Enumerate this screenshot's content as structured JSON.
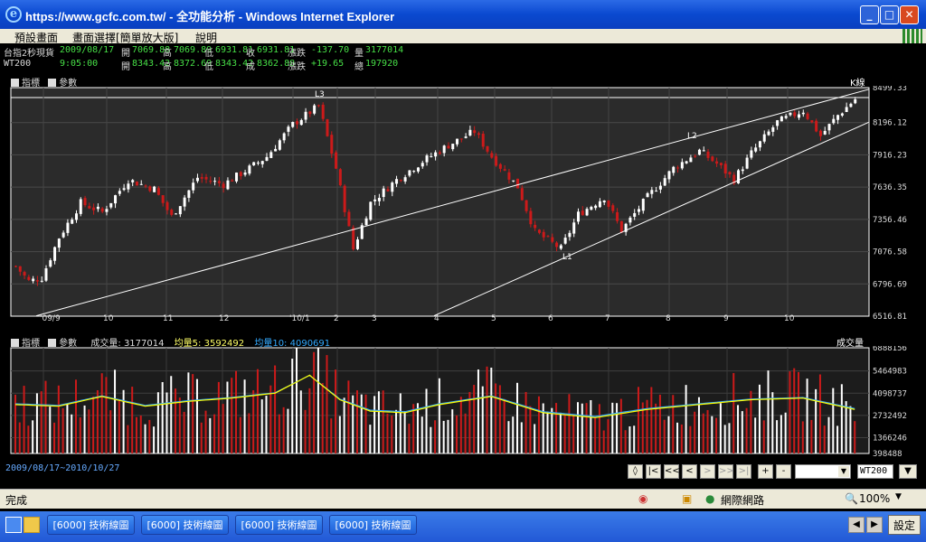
{
  "window": {
    "title": "https://www.gcfc.com.tw/ - 全功能分析 - Windows Internet Explorer"
  },
  "menu": [
    "預設畫面",
    "畫面選擇[簡單放大版]",
    "說明"
  ],
  "quotes": [
    {
      "name": "台指2秒現貨",
      "time": "2009/08/17",
      "open_label": "開",
      "open": "7069.88",
      "high_label": "高",
      "high": "7069.89",
      "low_label": "低",
      "low": "6931.81",
      "close_label": "收",
      "close": "6931.81",
      "chg_label": "漲跌",
      "chg": "-137.70",
      "vol_label": "量",
      "vol": "3177014"
    },
    {
      "name": "WT200",
      "time": "9:05:00",
      "open_label": "開",
      "open": "8343.42",
      "high_label": "高",
      "high": "8372.69",
      "low_label": "低",
      "low": "8343.42",
      "close_label": "成",
      "close": "8362.88",
      "chg_label": "漲跌",
      "chg": "+19.65",
      "vol_label": "總",
      "vol": "197920"
    }
  ],
  "price_panel": {
    "tool_indicator": "指標",
    "tool_params": "參數",
    "chart_label": "K線",
    "y_ticks": [
      "8499.33",
      "8196.12",
      "7916.23",
      "7636.35",
      "7356.46",
      "7076.58",
      "6796.69",
      "6516.81"
    ],
    "x_ticks": [
      "'09/9",
      "10",
      "11",
      "12",
      "'10/1",
      "2",
      "3",
      "4",
      "5",
      "6",
      "7",
      "8",
      "9",
      "10"
    ],
    "annotations": [
      "L3",
      "L2",
      "L1"
    ]
  },
  "volume_panel": {
    "tool_indicator": "指標",
    "tool_params": "參數",
    "vol_label": "成交量:",
    "vol_value": "3177014",
    "ma5_label": "均量5:",
    "ma5_value": "3592492",
    "ma10_label": "均量10:",
    "ma10_value": "4090691",
    "chart_label": "成交量",
    "y_ticks": [
      "6888156",
      "5464983",
      "4098737",
      "2732492",
      "1366246",
      "398488"
    ]
  },
  "date_range": "2009/08/17~2010/10/27",
  "nav_buttons": [
    "|<",
    "<<",
    "<",
    ">",
    ">>",
    ">|",
    "+",
    "-"
  ],
  "symbol_input": "WT200",
  "status": {
    "done": "完成",
    "zone": "網際網路",
    "zoom": "100%"
  },
  "taskbar": {
    "tasks": [
      "[6000] 技術線圖",
      "[6000] 技術線圖",
      "[6000] 技術線圖",
      "[6000] 技術線圖"
    ],
    "settings": "設定"
  },
  "colors": {
    "down_candle": "#cc1a1a",
    "up_candle": "#ffffff",
    "ma5": "#ffff00",
    "ma10": "#33aaff"
  },
  "chart_data": {
    "type": "candlestick",
    "y_range": [
      6516.81,
      8499.33
    ],
    "close_path": [
      {
        "x": 0,
        "y": 6950
      },
      {
        "x": 3,
        "y": 6820
      },
      {
        "x": 6,
        "y": 6850
      },
      {
        "x": 10,
        "y": 7200
      },
      {
        "x": 15,
        "y": 7500
      },
      {
        "x": 20,
        "y": 7420
      },
      {
        "x": 26,
        "y": 7700
      },
      {
        "x": 32,
        "y": 7620
      },
      {
        "x": 36,
        "y": 7380
      },
      {
        "x": 42,
        "y": 7720
      },
      {
        "x": 48,
        "y": 7660
      },
      {
        "x": 54,
        "y": 7800
      },
      {
        "x": 58,
        "y": 7900
      },
      {
        "x": 64,
        "y": 8180
      },
      {
        "x": 70,
        "y": 8340
      },
      {
        "x": 74,
        "y": 7800
      },
      {
        "x": 78,
        "y": 7100
      },
      {
        "x": 82,
        "y": 7500
      },
      {
        "x": 88,
        "y": 7700
      },
      {
        "x": 94,
        "y": 7860
      },
      {
        "x": 100,
        "y": 8000
      },
      {
        "x": 106,
        "y": 8120
      },
      {
        "x": 110,
        "y": 7900
      },
      {
        "x": 116,
        "y": 7640
      },
      {
        "x": 120,
        "y": 7250
      },
      {
        "x": 126,
        "y": 7100
      },
      {
        "x": 130,
        "y": 7400
      },
      {
        "x": 136,
        "y": 7550
      },
      {
        "x": 140,
        "y": 7260
      },
      {
        "x": 146,
        "y": 7550
      },
      {
        "x": 152,
        "y": 7800
      },
      {
        "x": 158,
        "y": 7950
      },
      {
        "x": 162,
        "y": 7840
      },
      {
        "x": 166,
        "y": 7700
      },
      {
        "x": 170,
        "y": 7930
      },
      {
        "x": 176,
        "y": 8200
      },
      {
        "x": 182,
        "y": 8300
      },
      {
        "x": 186,
        "y": 8080
      },
      {
        "x": 190,
        "y": 8260
      },
      {
        "x": 194,
        "y": 8400
      }
    ],
    "volume_ma5_path": [
      {
        "x": 0,
        "y": 3400000
      },
      {
        "x": 10,
        "y": 3300000
      },
      {
        "x": 20,
        "y": 3900000
      },
      {
        "x": 30,
        "y": 3300000
      },
      {
        "x": 40,
        "y": 3600000
      },
      {
        "x": 50,
        "y": 3800000
      },
      {
        "x": 60,
        "y": 4100000
      },
      {
        "x": 68,
        "y": 5200000
      },
      {
        "x": 75,
        "y": 3700000
      },
      {
        "x": 82,
        "y": 3000000
      },
      {
        "x": 90,
        "y": 2900000
      },
      {
        "x": 98,
        "y": 3400000
      },
      {
        "x": 110,
        "y": 3900000
      },
      {
        "x": 122,
        "y": 2900000
      },
      {
        "x": 134,
        "y": 2600000
      },
      {
        "x": 146,
        "y": 3100000
      },
      {
        "x": 158,
        "y": 3400000
      },
      {
        "x": 170,
        "y": 3700000
      },
      {
        "x": 182,
        "y": 3800000
      },
      {
        "x": 194,
        "y": 3100000
      }
    ]
  }
}
